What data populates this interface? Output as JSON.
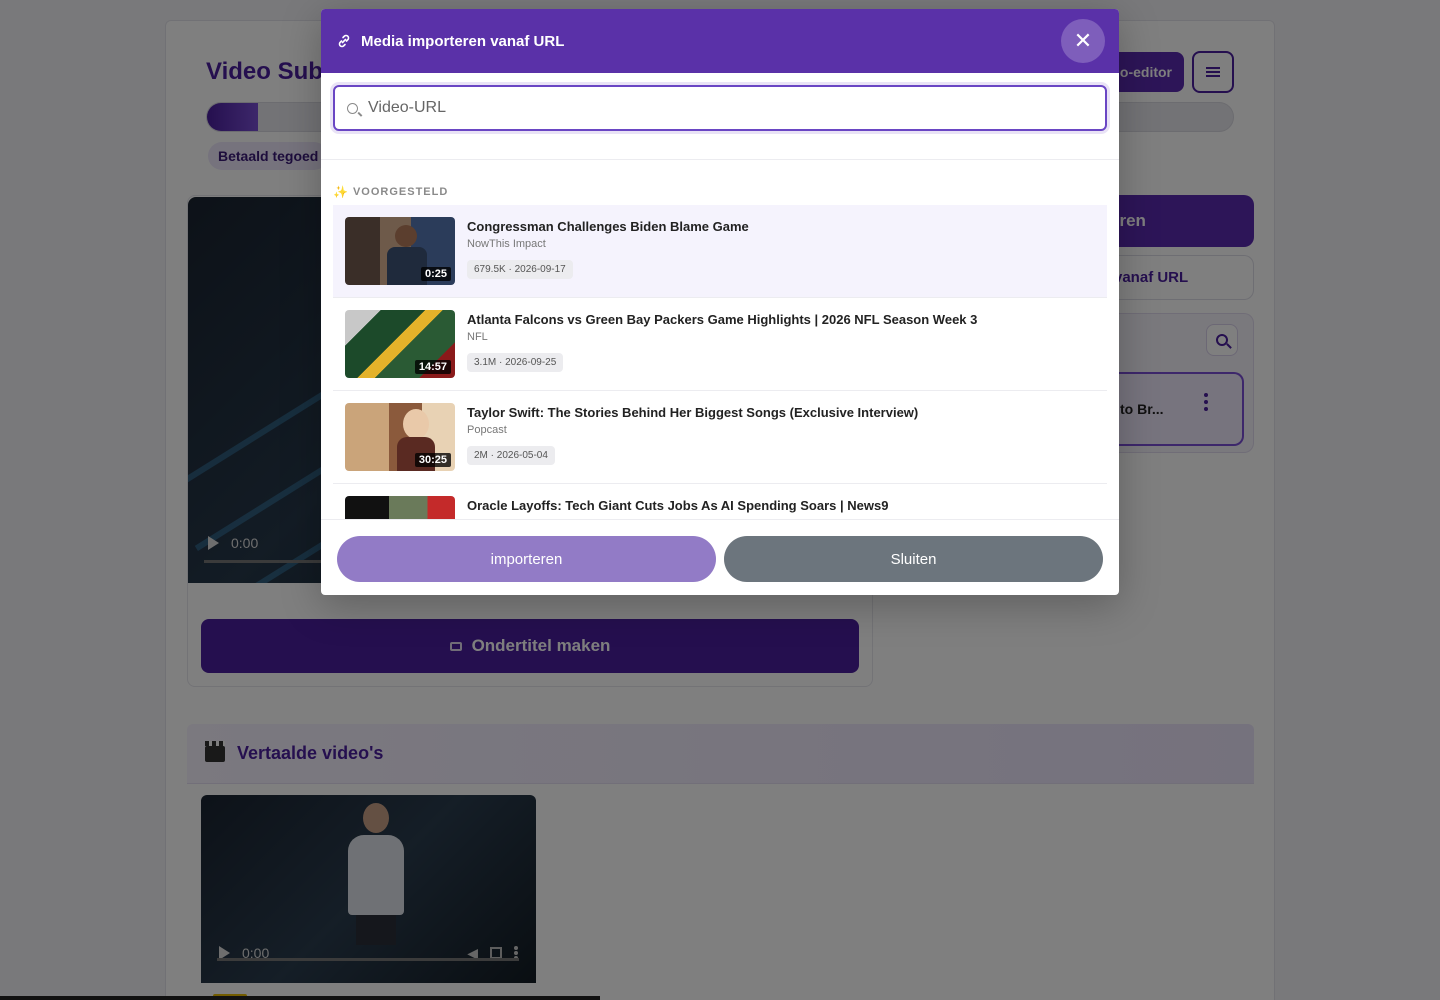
{
  "app": {
    "title": "Video Sub",
    "editor_button": "o-editor",
    "credit_badge": "Betaald tegoed",
    "progress": 0.05,
    "video_time": "0:00",
    "subtitle_button": "Ondertitel maken",
    "right_import_label": "eren",
    "right_url_label": "vanaf URL",
    "right_item_label": "to Br...",
    "translated_title": "Vertaalde video's",
    "translated_video_time": "0:00"
  },
  "modal": {
    "title": "Media importeren vanaf URL",
    "close_symbol": "✕",
    "search": {
      "placeholder": "Video-URL",
      "value": ""
    },
    "section_label": "VOORGESTELD",
    "section_icon": "✨",
    "items": [
      {
        "title": "Congressman Challenges Biden Blame Game",
        "channel": "NowThis Impact",
        "meta": "679.5K · 2026-09-17",
        "duration": "0:25"
      },
      {
        "title": "Atlanta Falcons vs Green Bay Packers Game Highlights | 2026 NFL Season Week 3",
        "channel": "NFL",
        "meta": "3.1M · 2026-09-25",
        "duration": "14:57"
      },
      {
        "title": "Taylor Swift: The Stories Behind Her Biggest Songs (Exclusive Interview)",
        "channel": "Popcast",
        "meta": "2M · 2026-05-04",
        "duration": "30:25"
      },
      {
        "title": "Oracle Layoffs: Tech Giant Cuts Jobs As AI Spending Soars | News9",
        "channel": "",
        "meta": "",
        "duration": ""
      }
    ],
    "import_button": "importeren",
    "close_button": "Sluiten"
  },
  "colors": {
    "brand_purple": "#5a31a8",
    "dark_purple": "#4b1f9e",
    "import_button": "#927bc6",
    "close_button": "#6c757d"
  }
}
